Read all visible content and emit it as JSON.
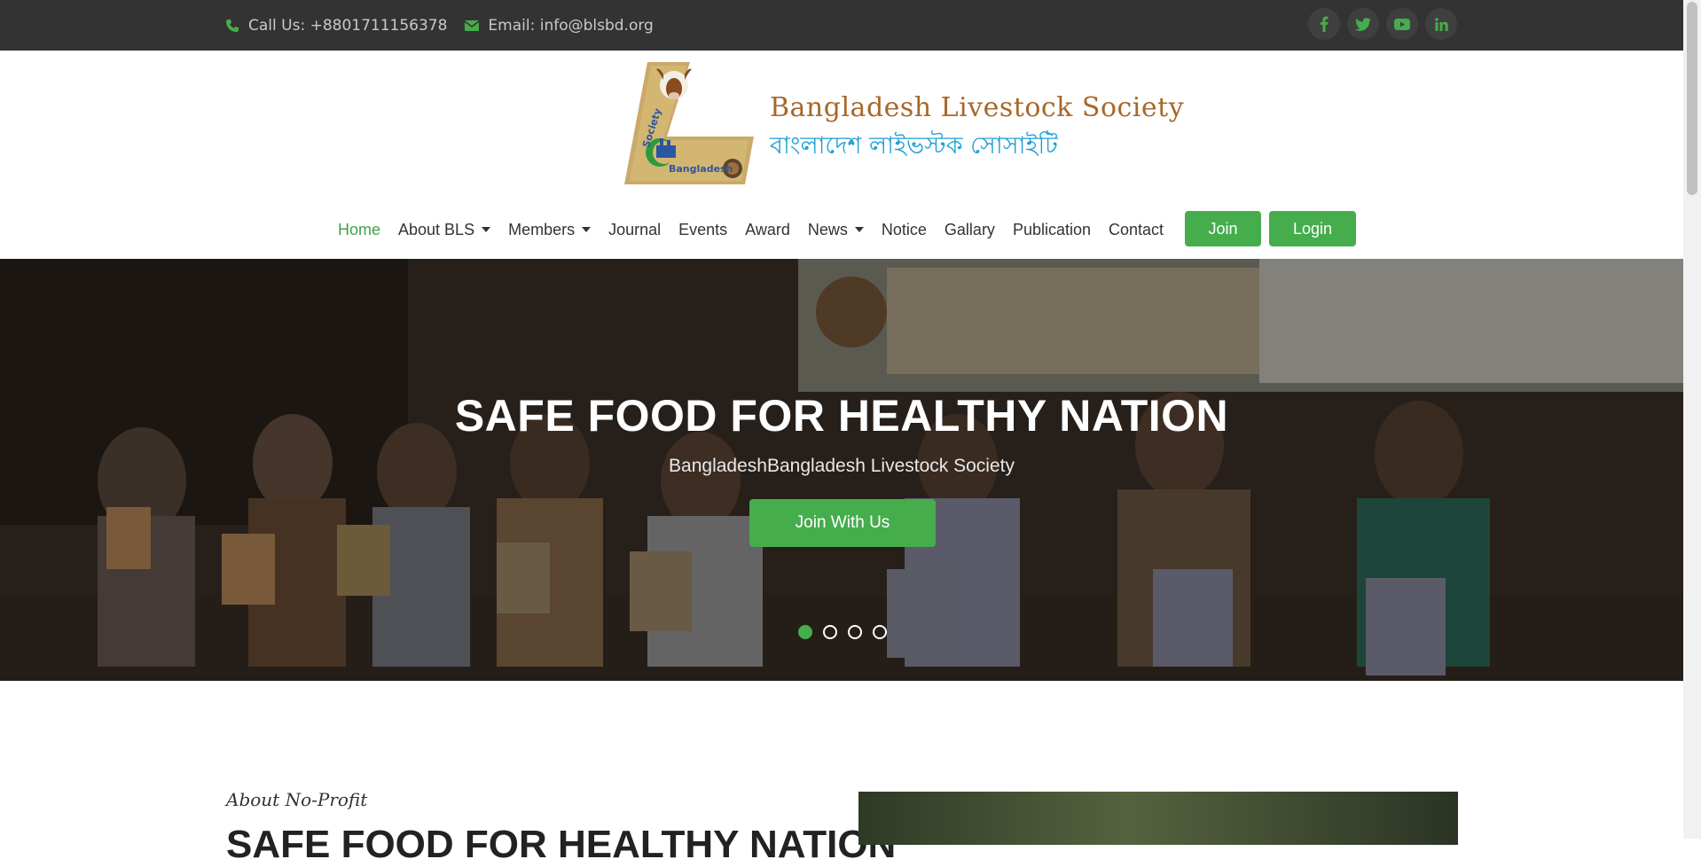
{
  "topbar": {
    "phone": "Call Us: +8801711156378",
    "email": "Email: info@blsbd.org",
    "social": [
      "facebook-icon",
      "twitter-icon",
      "youtube-icon",
      "linkedin-icon"
    ]
  },
  "header": {
    "logo_title_en": "Bangladesh Livestock Society",
    "logo_title_bn": "বাংলাদেশ লাইভস্টক সোসাইটি",
    "logo_badge_society": "Society",
    "logo_badge_country": "Bangladesh"
  },
  "nav": {
    "items": [
      {
        "label": "Home",
        "active": true,
        "dropdown": false
      },
      {
        "label": "About BLS",
        "dropdown": true
      },
      {
        "label": "Members",
        "dropdown": true
      },
      {
        "label": "Journal",
        "dropdown": false
      },
      {
        "label": "Events",
        "dropdown": false
      },
      {
        "label": "Award",
        "dropdown": false
      },
      {
        "label": "News",
        "dropdown": true
      },
      {
        "label": "Notice",
        "dropdown": false
      },
      {
        "label": "Gallary",
        "dropdown": false
      },
      {
        "label": "Publication",
        "dropdown": false
      },
      {
        "label": "Contact",
        "dropdown": false
      }
    ],
    "join_label": "Join",
    "login_label": "Login"
  },
  "hero": {
    "title": "SAFE FOOD FOR HEALTHY NATION",
    "subtitle": "BangladeshBangladesh Livestock Society",
    "button_label": "Join With Us",
    "slides": 4,
    "active_slide": 1
  },
  "about": {
    "eyebrow": "About No-Profit",
    "title": "SAFE FOOD FOR HEALTHY NATION"
  },
  "colors": {
    "accent": "#45ad4c",
    "topbar": "#333333",
    "logo_brown": "#a8672a",
    "logo_blue": "#1e9fd6"
  }
}
